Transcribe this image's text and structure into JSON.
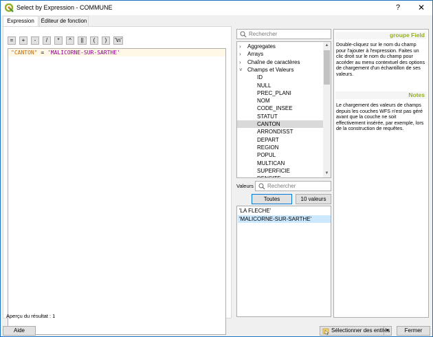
{
  "window": {
    "title": "Select by Expression - COMMUNE",
    "help_glyph": "?",
    "close_glyph": "✕"
  },
  "tabs": [
    {
      "label": "Expression",
      "active": true
    },
    {
      "label": "Éditeur de fonction",
      "active": false
    }
  ],
  "operators": [
    "=",
    "+",
    "-",
    "/",
    "*",
    "^",
    "||",
    "(",
    ")",
    "'\\n'"
  ],
  "expression": {
    "field": "\"CANTON\"",
    "op": " = ",
    "value": "'MALICORNE-SUR-SARTHE'"
  },
  "preview": {
    "label": "Aperçu du résultat :",
    "value": "1"
  },
  "search": {
    "placeholder": "Rechercher"
  },
  "tree": [
    {
      "label": "Aggregates",
      "chevron": "›",
      "child": false,
      "selected": false
    },
    {
      "label": "Arrays",
      "chevron": "›",
      "child": false,
      "selected": false
    },
    {
      "label": "Chaîne de caractères",
      "chevron": "›",
      "child": false,
      "selected": false
    },
    {
      "label": "Champs et Valeurs",
      "chevron": "˅",
      "child": false,
      "selected": false
    },
    {
      "label": "ID",
      "chevron": "",
      "child": true,
      "selected": false
    },
    {
      "label": "NULL",
      "chevron": "",
      "child": true,
      "selected": false
    },
    {
      "label": "PREC_PLANI",
      "chevron": "",
      "child": true,
      "selected": false
    },
    {
      "label": "NOM",
      "chevron": "",
      "child": true,
      "selected": false
    },
    {
      "label": "CODE_INSEE",
      "chevron": "",
      "child": true,
      "selected": false
    },
    {
      "label": "STATUT",
      "chevron": "",
      "child": true,
      "selected": false
    },
    {
      "label": "CANTON",
      "chevron": "",
      "child": true,
      "selected": true
    },
    {
      "label": "ARRONDISST",
      "chevron": "",
      "child": true,
      "selected": false
    },
    {
      "label": "DEPART",
      "chevron": "",
      "child": true,
      "selected": false
    },
    {
      "label": "REGION",
      "chevron": "",
      "child": true,
      "selected": false
    },
    {
      "label": "POPUL",
      "chevron": "",
      "child": true,
      "selected": false
    },
    {
      "label": "MULTICAN",
      "chevron": "",
      "child": true,
      "selected": false
    },
    {
      "label": "SUPERFICIE",
      "chevron": "",
      "child": true,
      "selected": false
    },
    {
      "label": "DENSITE",
      "chevron": "",
      "child": true,
      "selected": false
    }
  ],
  "values": {
    "label": "Valeurs",
    "search_placeholder": "Rechercher",
    "all_button": "Toutes",
    "ten_button": "10 valeurs",
    "items": [
      {
        "label": "'LA FLECHE'",
        "selected": false
      },
      {
        "label": "'MALICORNE-SUR-SARTHE'",
        "selected": true
      }
    ]
  },
  "help": {
    "title": "groupe Field",
    "body": "Double-cliquez sur le nom du champ pour l'ajouter à l'expression. Faites un clic droit sur le nom du champ pour accéder au menu contextuel des options de chargement d'un échantillon de ses valeurs.",
    "notes_title": "Notes",
    "notes_body": "Le chargement des valeurs de champs depuis les couches WFS n'est pas géré avant que la couche ne soit effectivement insérée, par exemple, lors de la construction de requêtes."
  },
  "buttons": {
    "help": "Aide",
    "select_features": "Sélectionner des entités",
    "close": "Fermer"
  },
  "colors": {
    "accent": "#0078d7",
    "help_heading": "#93b023",
    "selected_value": "#cce8ff"
  }
}
